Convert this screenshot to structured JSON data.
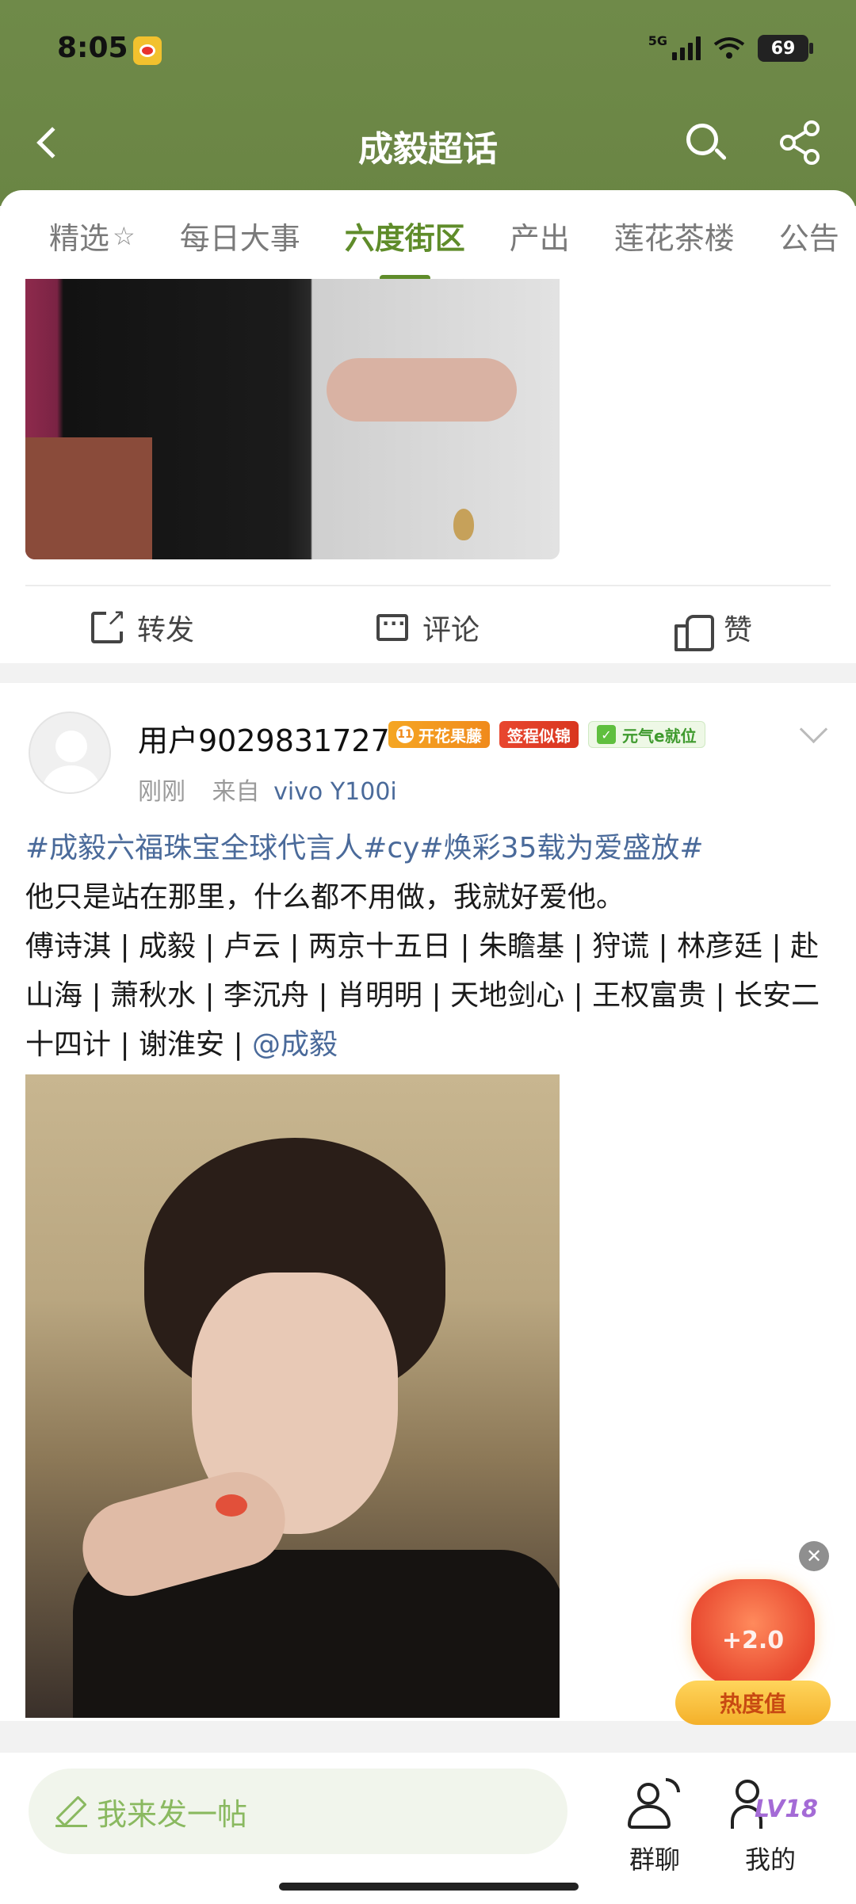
{
  "status_bar": {
    "time": "8:05",
    "network": "5G",
    "battery": "69"
  },
  "header": {
    "title": "成毅超话"
  },
  "tabs": [
    {
      "label": "精选",
      "active": false,
      "has_icon": true
    },
    {
      "label": "每日大事",
      "active": false
    },
    {
      "label": "六度街区",
      "active": true
    },
    {
      "label": "产出",
      "active": false
    },
    {
      "label": "莲花茶楼",
      "active": false
    },
    {
      "label": "公告",
      "active": false
    }
  ],
  "post_actions": {
    "forward": "转发",
    "comment": "评论",
    "like": "赞"
  },
  "post2": {
    "username": "用户9029831727",
    "badges": {
      "b1_level": "11",
      "b1": "开花果藤",
      "b2": "签程似锦",
      "b3": "元气e就位"
    },
    "time": "刚刚",
    "source_prefix": "来自",
    "device": "vivo Y100i",
    "line1_tags": "#成毅六福珠宝全球代言人#cy#焕彩35载为爱盛放#",
    "line2": "他只是站在那里，什么都不用做，我就好爱他。",
    "line3": "傅诗淇 | 成毅 | 卢云 | 两京十五日 | 朱瞻基 | 狩谎 | 林彦廷 | 赴山海 | 萧秋水 | 李沉舟 | 肖明明 | 天地剑心 | 王权富贵 | 长安二十四计 | 谢淮安 | ",
    "mention": "@成毅"
  },
  "reward": {
    "value": "+2.0",
    "label": "热度值"
  },
  "bottom_bar": {
    "composer_placeholder": "我来发一帖",
    "group_chat": "群聊",
    "mine": "我的",
    "level": "LV18"
  },
  "colors": {
    "header_green": "#6f8a49",
    "active_tab": "#5f8c2a",
    "link_blue": "#4a6a9a"
  }
}
